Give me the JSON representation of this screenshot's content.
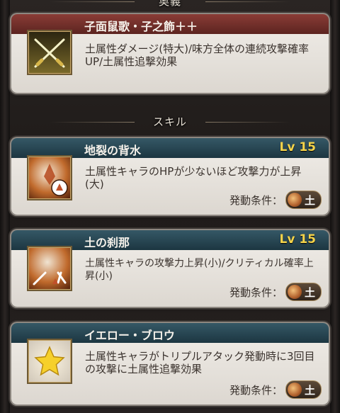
{
  "ougi_header": "奥義",
  "ougi": {
    "name": "子面鼠歌・子之飾＋＋",
    "description": "土属性ダメージ(特大)/味方全体の連続攻撃確率UP/土属性追撃効果",
    "icon": "crossed-swords-icon"
  },
  "skill_header": "スキル",
  "skills": [
    {
      "name": "地裂の背水",
      "level": "Lv 15",
      "description": "土属性キャラのHPが少ないほど攻撃力が上昇(大)",
      "condition_label": "発動条件：",
      "element": "土",
      "icon": "earth-backwater-icon"
    },
    {
      "name": "土の刹那",
      "level": "Lv 15",
      "description": "土属性キャラの攻撃力上昇(小)/クリティカル確率上昇(小)",
      "condition_label": "発動条件：",
      "element": "土",
      "icon": "earth-critical-icon"
    },
    {
      "name": "イエロー・ブロウ",
      "level": "",
      "description": "土属性キャラがトリプルアタック発動時に3回目の攻撃に土属性追撃効果",
      "condition_label": "発動条件：",
      "element": "土",
      "icon": "star-icon"
    }
  ]
}
